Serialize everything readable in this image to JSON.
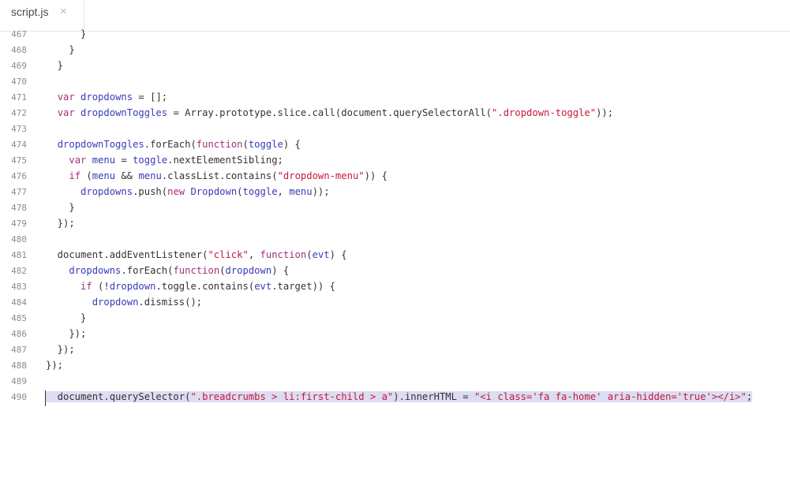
{
  "tab": {
    "title": "script.js",
    "close": "×"
  },
  "colors": {
    "keyword": "#a0317a",
    "variable": "#3a3ab8",
    "string": "#c41a3a",
    "plain": "#333333",
    "selection": "#dcdcf2"
  },
  "lines": [
    {
      "num": "467",
      "tokens": [
        [
          "p",
          "      }"
        ]
      ]
    },
    {
      "num": "468",
      "tokens": [
        [
          "p",
          "    }"
        ]
      ]
    },
    {
      "num": "469",
      "tokens": [
        [
          "p",
          "  }"
        ]
      ]
    },
    {
      "num": "470",
      "tokens": []
    },
    {
      "num": "471",
      "tokens": [
        [
          "p",
          "  "
        ],
        [
          "k",
          "var"
        ],
        [
          "p",
          " "
        ],
        [
          "v",
          "dropdowns"
        ],
        [
          "p",
          " = [];"
        ]
      ]
    },
    {
      "num": "472",
      "tokens": [
        [
          "p",
          "  "
        ],
        [
          "k",
          "var"
        ],
        [
          "p",
          " "
        ],
        [
          "v",
          "dropdownToggles"
        ],
        [
          "p",
          " = Array.prototype.slice.call(document.querySelectorAll("
        ],
        [
          "s",
          "\".dropdown-toggle\""
        ],
        [
          "p",
          "));"
        ]
      ]
    },
    {
      "num": "473",
      "tokens": []
    },
    {
      "num": "474",
      "tokens": [
        [
          "p",
          "  "
        ],
        [
          "v",
          "dropdownToggles"
        ],
        [
          "p",
          ".forEach("
        ],
        [
          "k",
          "function"
        ],
        [
          "p",
          "("
        ],
        [
          "v",
          "toggle"
        ],
        [
          "p",
          ") {"
        ]
      ]
    },
    {
      "num": "475",
      "tokens": [
        [
          "p",
          "    "
        ],
        [
          "k",
          "var"
        ],
        [
          "p",
          " "
        ],
        [
          "v",
          "menu"
        ],
        [
          "p",
          " = "
        ],
        [
          "v",
          "toggle"
        ],
        [
          "p",
          ".nextElementSibling;"
        ]
      ]
    },
    {
      "num": "476",
      "tokens": [
        [
          "p",
          "    "
        ],
        [
          "k",
          "if"
        ],
        [
          "p",
          " ("
        ],
        [
          "v",
          "menu"
        ],
        [
          "p",
          " && "
        ],
        [
          "v",
          "menu"
        ],
        [
          "p",
          ".classList.contains("
        ],
        [
          "s",
          "\"dropdown-menu\""
        ],
        [
          "p",
          ")) {"
        ]
      ]
    },
    {
      "num": "477",
      "tokens": [
        [
          "p",
          "      "
        ],
        [
          "v",
          "dropdowns"
        ],
        [
          "p",
          ".push("
        ],
        [
          "k",
          "new"
        ],
        [
          "p",
          " "
        ],
        [
          "v",
          "Dropdown"
        ],
        [
          "p",
          "("
        ],
        [
          "v",
          "toggle"
        ],
        [
          "p",
          ", "
        ],
        [
          "v",
          "menu"
        ],
        [
          "p",
          "));"
        ]
      ]
    },
    {
      "num": "478",
      "tokens": [
        [
          "p",
          "    }"
        ]
      ]
    },
    {
      "num": "479",
      "tokens": [
        [
          "p",
          "  });"
        ]
      ]
    },
    {
      "num": "480",
      "tokens": []
    },
    {
      "num": "481",
      "tokens": [
        [
          "p",
          "  document.addEventListener("
        ],
        [
          "s",
          "\"click\""
        ],
        [
          "p",
          ", "
        ],
        [
          "k",
          "function"
        ],
        [
          "p",
          "("
        ],
        [
          "v",
          "evt"
        ],
        [
          "p",
          ") {"
        ]
      ]
    },
    {
      "num": "482",
      "tokens": [
        [
          "p",
          "    "
        ],
        [
          "v",
          "dropdowns"
        ],
        [
          "p",
          ".forEach("
        ],
        [
          "k",
          "function"
        ],
        [
          "p",
          "("
        ],
        [
          "v",
          "dropdown"
        ],
        [
          "p",
          ") {"
        ]
      ]
    },
    {
      "num": "483",
      "tokens": [
        [
          "p",
          "      "
        ],
        [
          "k",
          "if"
        ],
        [
          "p",
          " (!"
        ],
        [
          "v",
          "dropdown"
        ],
        [
          "p",
          ".toggle.contains("
        ],
        [
          "v",
          "evt"
        ],
        [
          "p",
          ".target)) {"
        ]
      ]
    },
    {
      "num": "484",
      "tokens": [
        [
          "p",
          "        "
        ],
        [
          "v",
          "dropdown"
        ],
        [
          "p",
          ".dismiss();"
        ]
      ]
    },
    {
      "num": "485",
      "tokens": [
        [
          "p",
          "      }"
        ]
      ]
    },
    {
      "num": "486",
      "tokens": [
        [
          "p",
          "    });"
        ]
      ]
    },
    {
      "num": "487",
      "tokens": [
        [
          "p",
          "  });"
        ]
      ]
    },
    {
      "num": "488",
      "tokens": [
        [
          "p",
          "});"
        ]
      ]
    },
    {
      "num": "489",
      "tokens": []
    },
    {
      "num": "490",
      "selected": true,
      "tokens": [
        [
          "p",
          "  document.querySelector("
        ],
        [
          "s",
          "\".breadcrumbs > li:first-child > a\""
        ],
        [
          "p",
          ").innerHTML = "
        ],
        [
          "s",
          "\"<i class='fa fa-home' aria-hidden='true'></i>\""
        ],
        [
          "p",
          ";"
        ]
      ]
    }
  ]
}
